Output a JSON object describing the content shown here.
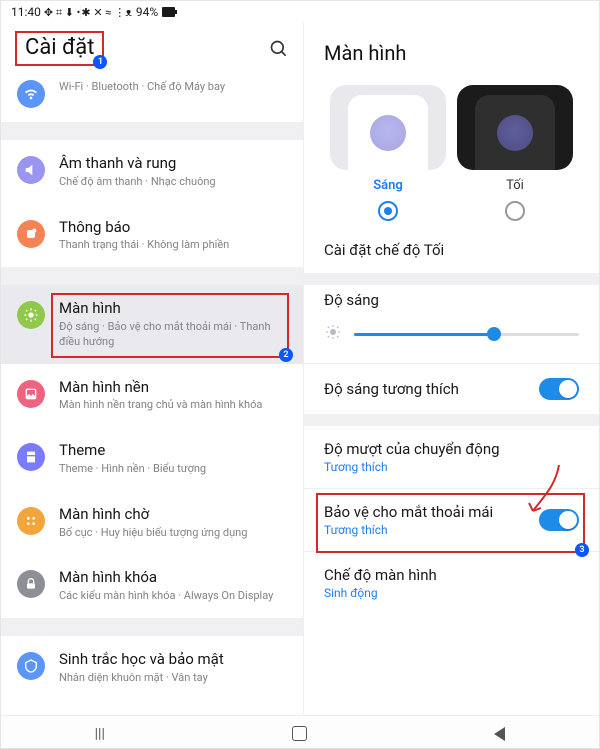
{
  "status": {
    "time": "11:40",
    "left_icons": "✥ ⌗ ⬇ •",
    "right_icons": "✱ ✕ ≈ ⋮ᴥ",
    "battery": "94%"
  },
  "left": {
    "header_title": "Cài đặt",
    "items": {
      "connections": {
        "sub": "Wi-Fi  ·  Bluetooth  ·  Chế độ Máy bay"
      },
      "sound": {
        "title": "Âm thanh và rung",
        "sub": "Chế độ âm thanh  ·  Nhạc chuông"
      },
      "notif": {
        "title": "Thông báo",
        "sub": "Thanh trạng thái  ·  Không làm phiền"
      },
      "display": {
        "title": "Màn hình",
        "sub": "Độ sáng  ·  Bảo vệ cho mắt thoải mái  ·  Thanh điều hướng"
      },
      "wall": {
        "title": "Màn hình nền",
        "sub": "Màn hình nền trang chủ và màn hình khóa"
      },
      "theme": {
        "title": "Theme",
        "sub": "Theme  ·  Hình nền  ·  Biểu tượng"
      },
      "home": {
        "title": "Màn hình chờ",
        "sub": "Bố cục  ·  Huy hiệu biểu tượng ứng dụng"
      },
      "lock": {
        "title": "Màn hình khóa",
        "sub": "Các kiểu màn hình khóa  ·  Always On Display"
      },
      "bio": {
        "title": "Sinh trắc học và bảo mật",
        "sub": "Nhân diện khuôn mặt  ·  Vân tay"
      }
    }
  },
  "right": {
    "header": "Màn hình",
    "theme_light": "Sáng",
    "theme_dark": "Tối",
    "dark_mode_settings": "Cài đặt chế độ Tối",
    "brightness_label": "Độ sáng",
    "brightness_value": 62,
    "adaptive_brightness": "Độ sáng tương thích",
    "motion_smooth": {
      "title": "Độ mượt của chuyển động",
      "sub": "Tương thích"
    },
    "eye_comfort": {
      "title": "Bảo vệ cho mắt thoải mái",
      "sub": "Tương thích"
    },
    "screen_mode": {
      "title": "Chế độ màn hình",
      "sub": "Sinh động"
    }
  },
  "badges": {
    "b1": "1",
    "b2": "2",
    "b3": "3"
  }
}
